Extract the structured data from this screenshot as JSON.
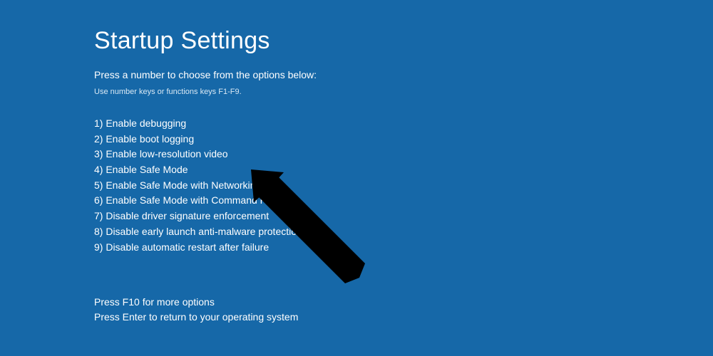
{
  "title": "Startup Settings",
  "subtitle": "Press a number to choose from the options below:",
  "hint": "Use number keys or functions keys F1-F9.",
  "options": [
    "1) Enable debugging",
    "2) Enable boot logging",
    "3) Enable low-resolution video",
    "4) Enable Safe Mode",
    "5) Enable Safe Mode with Networking",
    "6) Enable Safe Mode with Command Prompt",
    "7) Disable driver signature enforcement",
    "8) Disable early launch anti-malware protection",
    "9) Disable automatic restart after failure"
  ],
  "footer": {
    "line1": "Press F10 for more options",
    "line2": "Press Enter to return to your operating system"
  }
}
